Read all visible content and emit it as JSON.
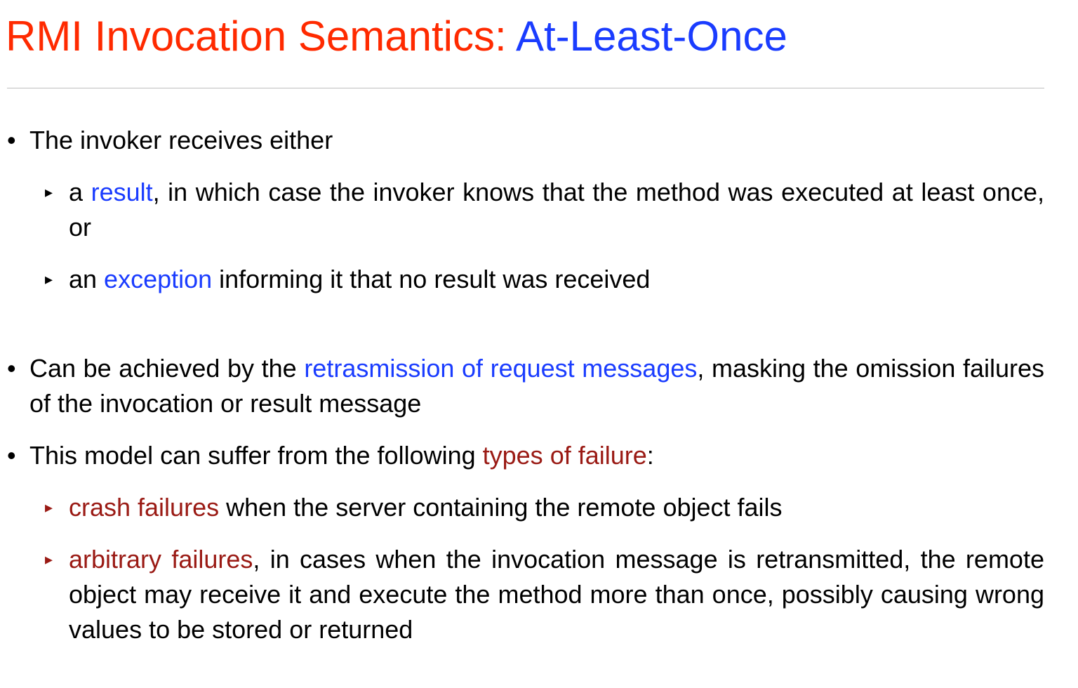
{
  "slide": {
    "title": {
      "part1": "RMI Invocation Semantics: ",
      "part2": "At-Least-Once"
    },
    "bullets": [
      {
        "text": "The invoker receives either",
        "sub": [
          {
            "pre": "a ",
            "hl": "result",
            "post": ", in which case the invoker knows that the method was executed at least once, or"
          },
          {
            "pre": "an ",
            "hl": "exception",
            "post": " informing it that no result was received"
          }
        ]
      },
      {
        "pre": "Can be achieved by the ",
        "hl": "retrasmission of request messages",
        "post": ", masking the omission failures of the invocation or result message"
      },
      {
        "pre": "This model can suffer from the following ",
        "hl": "types of failure",
        "post": ":",
        "sub": [
          {
            "hl": "crash failures",
            "post": " when the server containing the remote object fails"
          },
          {
            "hl": "arbitrary failures",
            "post": ", in cases when the invocation message is retransmitted, the remote object may receive it and execute the method more than once, possibly causing wrong values to be stored or returned"
          }
        ]
      }
    ],
    "markers": {
      "bullet": "•",
      "sub_bullet": "▸"
    },
    "colors": {
      "title_red": "#ff2a00",
      "title_blue": "#1a3cff",
      "highlight_blue": "#1a3cff",
      "highlight_darkred": "#9a1a14",
      "rule": "#bfbfbf"
    }
  }
}
